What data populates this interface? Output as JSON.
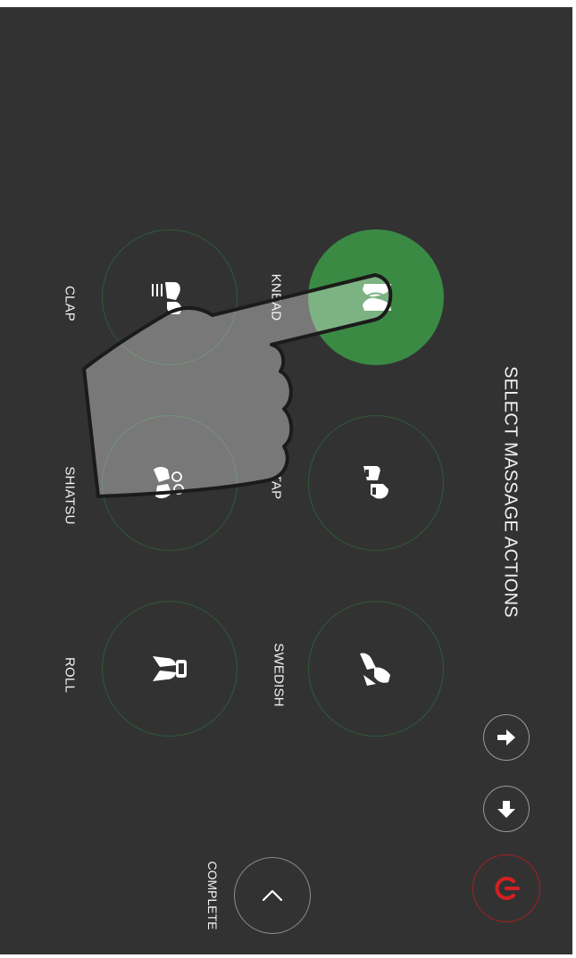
{
  "title": "SELECT MASSAGE ACTIONS",
  "actions": [
    {
      "id": "knead",
      "label": "KNEAD",
      "selected": true,
      "icon": "knead-hands-icon"
    },
    {
      "id": "tap",
      "label": "TAP",
      "selected": false,
      "icon": "tap-hands-icon"
    },
    {
      "id": "swedish",
      "label": "SWEDISH",
      "selected": false,
      "icon": "swedish-hands-icon"
    },
    {
      "id": "clap",
      "label": "CLAP",
      "selected": false,
      "icon": "clap-hands-icon"
    },
    {
      "id": "shiatsu",
      "label": "SHIATSU",
      "selected": false,
      "icon": "shiatsu-hands-icon"
    },
    {
      "id": "roll",
      "label": "ROLL",
      "selected": false,
      "icon": "roll-hands-icon"
    }
  ],
  "complete_label": "COMPLETE",
  "colors": {
    "background": "#323233",
    "selected": "#3a8a44",
    "ring": "#2f5a35",
    "power": "#d42020",
    "text": "#f2f2f2"
  },
  "icons": {
    "up": "arrow-up-icon",
    "right": "arrow-right-icon",
    "power": "power-icon",
    "back": "chevron-left-icon",
    "gesture": "pointing-hand-icon"
  }
}
